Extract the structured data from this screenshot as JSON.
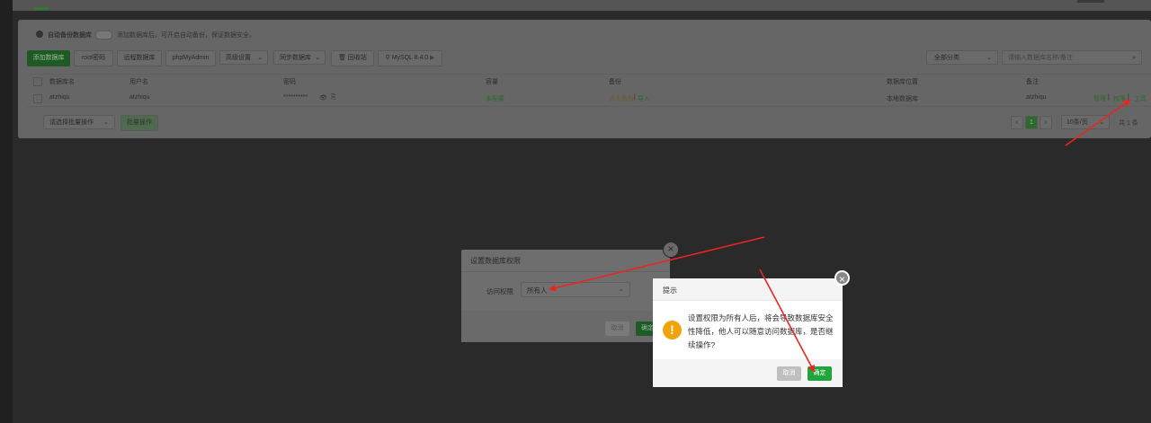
{
  "header": {
    "title_strip": ""
  },
  "notice": {
    "label": "自动备份数据库",
    "description": "添加数据库后，可开启自动备份，保证数据安全。"
  },
  "toolbar": {
    "add_db": "添加数据库",
    "root_password": "root密码",
    "remote_db": "远程数据库",
    "phpmyadmin": "phpMyAdmin",
    "advanced": "高级设置",
    "sync_db": "同步数据库",
    "recycle": "回收站",
    "mysql_version": "MySQL 8.4.0",
    "category": "全部分类",
    "search_placeholder": "请输入数据库名称/备注"
  },
  "table": {
    "headers": [
      "数据库名",
      "用户名",
      "密码",
      "容量",
      "备份",
      "数据库位置",
      "备注"
    ],
    "rows": [
      {
        "name": "atzhiqu",
        "user": "atzhiqu",
        "password": "**********",
        "capacity": "未配置",
        "backup_state": "点击备份",
        "backup_import": "导入",
        "location": "本地数据库",
        "remark": "atzhiqu",
        "actions": [
          "管理",
          "权限",
          "工具"
        ]
      }
    ]
  },
  "pagination": {
    "batch_placeholder": "请选择批量操作",
    "batch_button": "批量操作",
    "current_page": "1",
    "per_page": "10条/页",
    "total": "共 1 条"
  },
  "modal_permission": {
    "title": "设置数据库权限",
    "field_label": "访问权限",
    "field_value": "所有人",
    "cancel": "取消",
    "confirm": "确定"
  },
  "modal_prompt": {
    "title": "提示",
    "message": "设置权限为所有人后，将会导致数据库安全性降低，他人可以随意访问数据库，是否继续操作?",
    "cancel": "取消",
    "confirm": "确定"
  },
  "colors": {
    "accent_green": "#20a53a",
    "warning": "#f0a30a",
    "arrow_red": "#e8261f"
  }
}
